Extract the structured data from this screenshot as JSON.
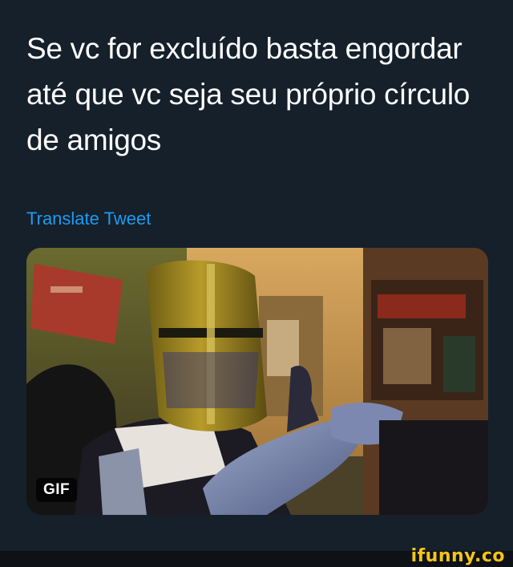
{
  "tweet": {
    "text": "Se vc for excluído basta engordar até que vc seja seu próprio círculo de amigos",
    "translate_label": "Translate Tweet"
  },
  "media": {
    "badge": "GIF",
    "description_icon": "knight-helmet-image"
  },
  "watermark": {
    "text": "ifunny.co"
  },
  "colors": {
    "background": "#15202b",
    "link": "#1d9bf0",
    "text": "#ffffff",
    "watermark": "#f5c518"
  }
}
